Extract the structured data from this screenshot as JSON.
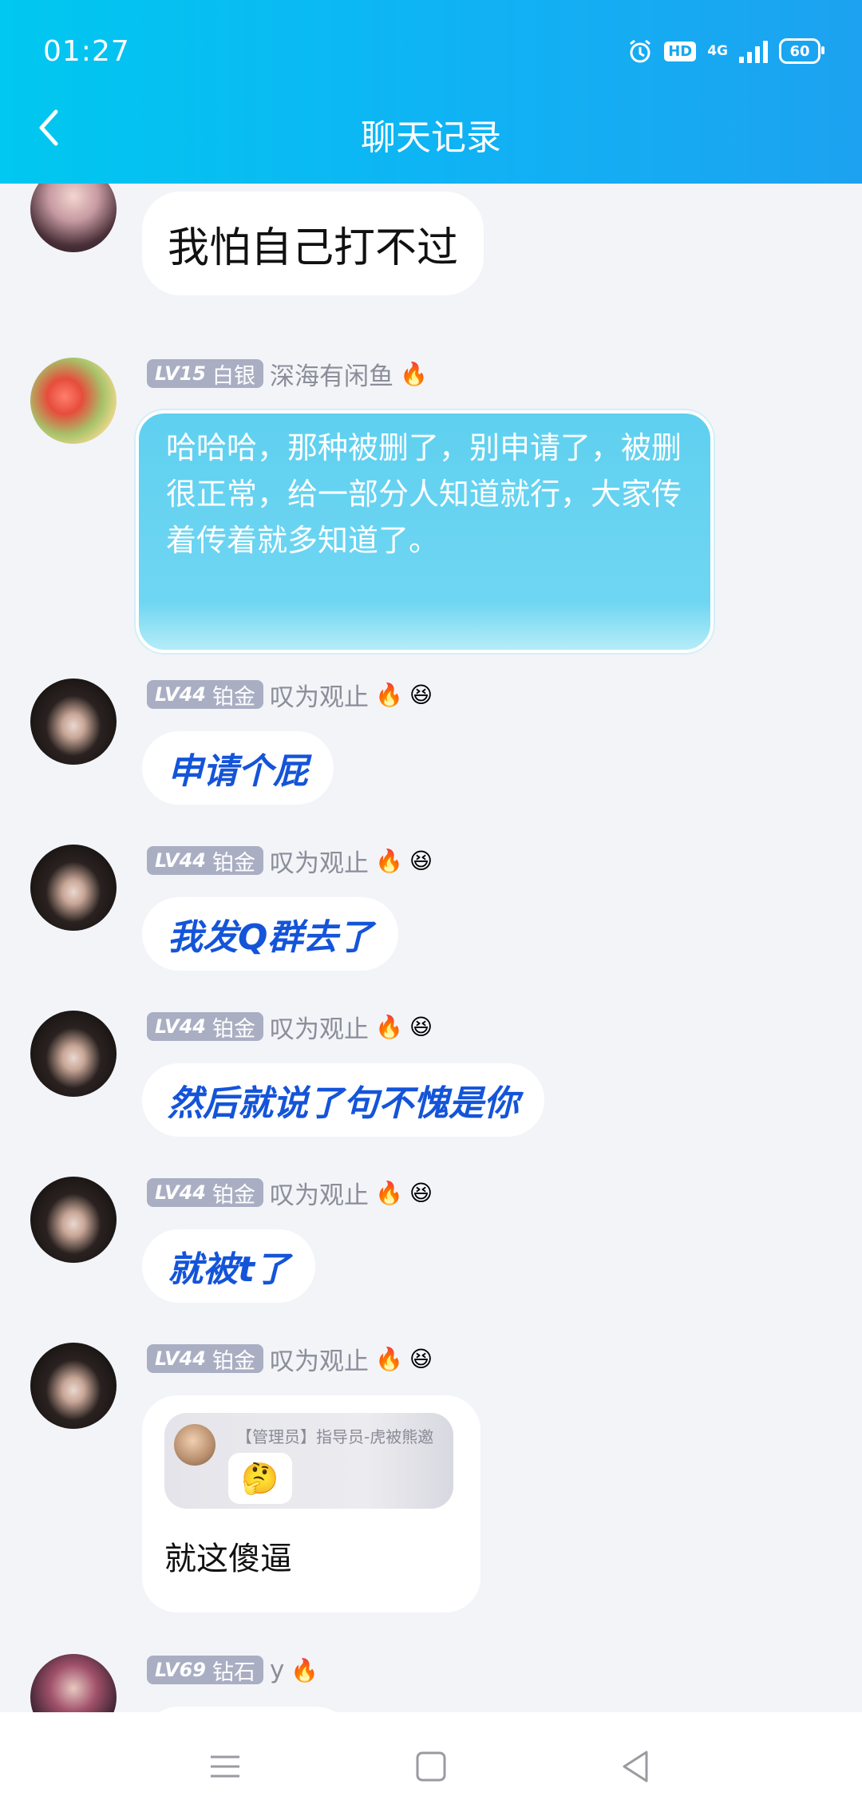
{
  "status_bar": {
    "time": "01:27",
    "hd": "HD",
    "network": "4G",
    "battery": "60"
  },
  "header": {
    "title": "聊天记录"
  },
  "messages": [
    {
      "avatar": "girl-avatar",
      "text": "我怕自己打不过"
    },
    {
      "level": "LV15",
      "rank": "白银",
      "name": "深海有闲鱼",
      "badges": [
        "🔥"
      ],
      "text": "哈哈哈，那种被删了，别申请了，被删很正常，给一部分人知道就行，大家传着传着就多知道了。"
    },
    {
      "level": "LV44",
      "rank": "铂金",
      "name": "叹为观止",
      "badges": [
        "🔥",
        "😆"
      ],
      "text": "申请个屁"
    },
    {
      "level": "LV44",
      "rank": "铂金",
      "name": "叹为观止",
      "badges": [
        "🔥",
        "😆"
      ],
      "text": "我发Q群去了"
    },
    {
      "level": "LV44",
      "rank": "铂金",
      "name": "叹为观止",
      "badges": [
        "🔥",
        "😆"
      ],
      "text": "然后就说了句不愧是你"
    },
    {
      "level": "LV44",
      "rank": "铂金",
      "name": "叹为观止",
      "badges": [
        "🔥",
        "😆"
      ],
      "text": "就被t了"
    },
    {
      "level": "LV44",
      "rank": "铂金",
      "name": "叹为观止",
      "badges": [
        "🔥",
        "😆"
      ],
      "quote": {
        "name": "【管理员】指导员-虎被熊邀",
        "emoji": "🤔"
      },
      "text": "就这傻逼"
    },
    {
      "level": "LV69",
      "rank": "钻石",
      "name": "y",
      "badges": [
        "🔥"
      ]
    }
  ],
  "colors": {
    "header_start": "#00c8f0",
    "header_end": "#1da2f0",
    "level_badge": "#a9aec3",
    "blue_text": "#1454d9",
    "background": "#f2f4f8"
  }
}
